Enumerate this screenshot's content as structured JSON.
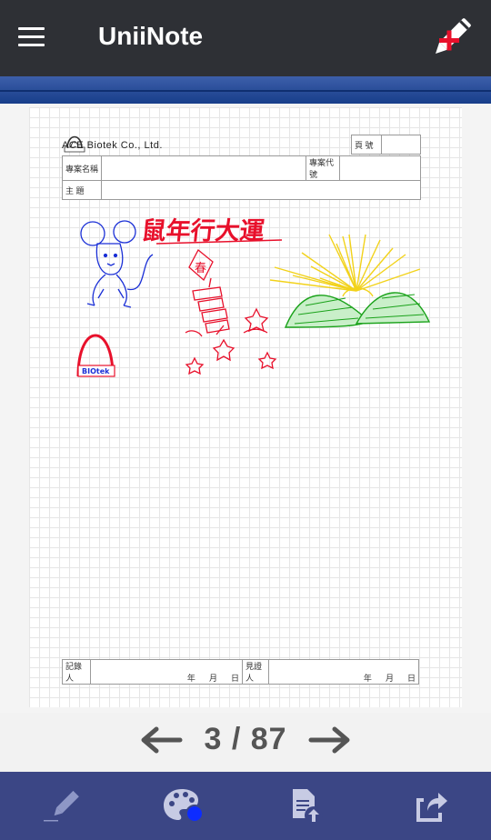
{
  "app": {
    "title": "UniiNote"
  },
  "page": {
    "company": "ACE Biotek Co., Ltd.",
    "logo_text": "Biotek",
    "header": {
      "number_label": "頁  號",
      "project_name_label": "專案名稱",
      "project_code_label": "專案代號",
      "subject_label": "主   題"
    },
    "footer": {
      "recorder_label": "記錄人",
      "witness_label": "見證人",
      "year": "年",
      "month": "月",
      "day": "日"
    },
    "drawing": {
      "title_text": "鼠年行大運",
      "firecracker_char": "春",
      "logo_sketch_text": "BIOtek"
    }
  },
  "pager": {
    "current": "3",
    "separator": "/",
    "total": "87"
  },
  "colors": {
    "appbar": "#2e3035",
    "band": "#1e4690",
    "bottombar": "#3b4685",
    "accent_red": "#e8102b",
    "indicator_dot": "#0d2cff"
  }
}
